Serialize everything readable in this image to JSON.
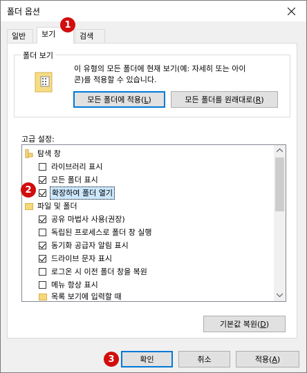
{
  "window": {
    "title": "폴더 옵션"
  },
  "tabs": [
    {
      "label": "일반"
    },
    {
      "label": "보기"
    },
    {
      "label": "검색"
    }
  ],
  "folder_views": {
    "group_title": "폴더 보기",
    "description_line1": "이 유형의 모든 폴더에 현재 보기(예: 자세히 또는 아이",
    "description_line2": "콘)를 적용할 수 있습니다.",
    "apply_button": {
      "text": "모든 폴더에 적용(",
      "hotkey": "L",
      "suffix": ")"
    },
    "reset_button": {
      "text": "모든 폴더를 원래대로(",
      "hotkey": "R",
      "suffix": ")"
    }
  },
  "advanced": {
    "label": "고급 설정:",
    "items": [
      {
        "type": "folder",
        "label": "탐색 창"
      },
      {
        "type": "checkbox",
        "checked": false,
        "label": "라이브러리 표시"
      },
      {
        "type": "checkbox",
        "checked": true,
        "label": "모든 폴더 표시"
      },
      {
        "type": "checkbox",
        "checked": true,
        "label": "확장하여 폴더 열기",
        "selected": true
      },
      {
        "type": "folder",
        "label": "파일 및 폴더"
      },
      {
        "type": "checkbox",
        "checked": true,
        "label": "공유 마법사 사용(권장)"
      },
      {
        "type": "checkbox",
        "checked": false,
        "label": "독립된 프로세스로 폴더 창 실행"
      },
      {
        "type": "checkbox",
        "checked": true,
        "label": "동기화 공급자 알림 표시"
      },
      {
        "type": "checkbox",
        "checked": true,
        "label": "드라이브 문자 표시"
      },
      {
        "type": "checkbox",
        "checked": false,
        "label": "로그온 시 이전 폴더 창을 복원"
      },
      {
        "type": "checkbox",
        "checked": false,
        "label": "메뉴 항상 표시"
      },
      {
        "type": "folder",
        "label": "목록 보기에 입력할 때"
      }
    ],
    "restore_defaults": {
      "text": "기본값 복원(",
      "hotkey": "D",
      "suffix": ")"
    }
  },
  "footer": {
    "ok_label": "확인",
    "cancel_label": "취소",
    "apply": {
      "text": "적용(",
      "hotkey": "A",
      "suffix": ")"
    }
  },
  "badges": [
    "1",
    "2",
    "3"
  ],
  "colors": {
    "badge": "#d10d0d",
    "selection": "#cce8ff",
    "focus": "#0078d7"
  }
}
